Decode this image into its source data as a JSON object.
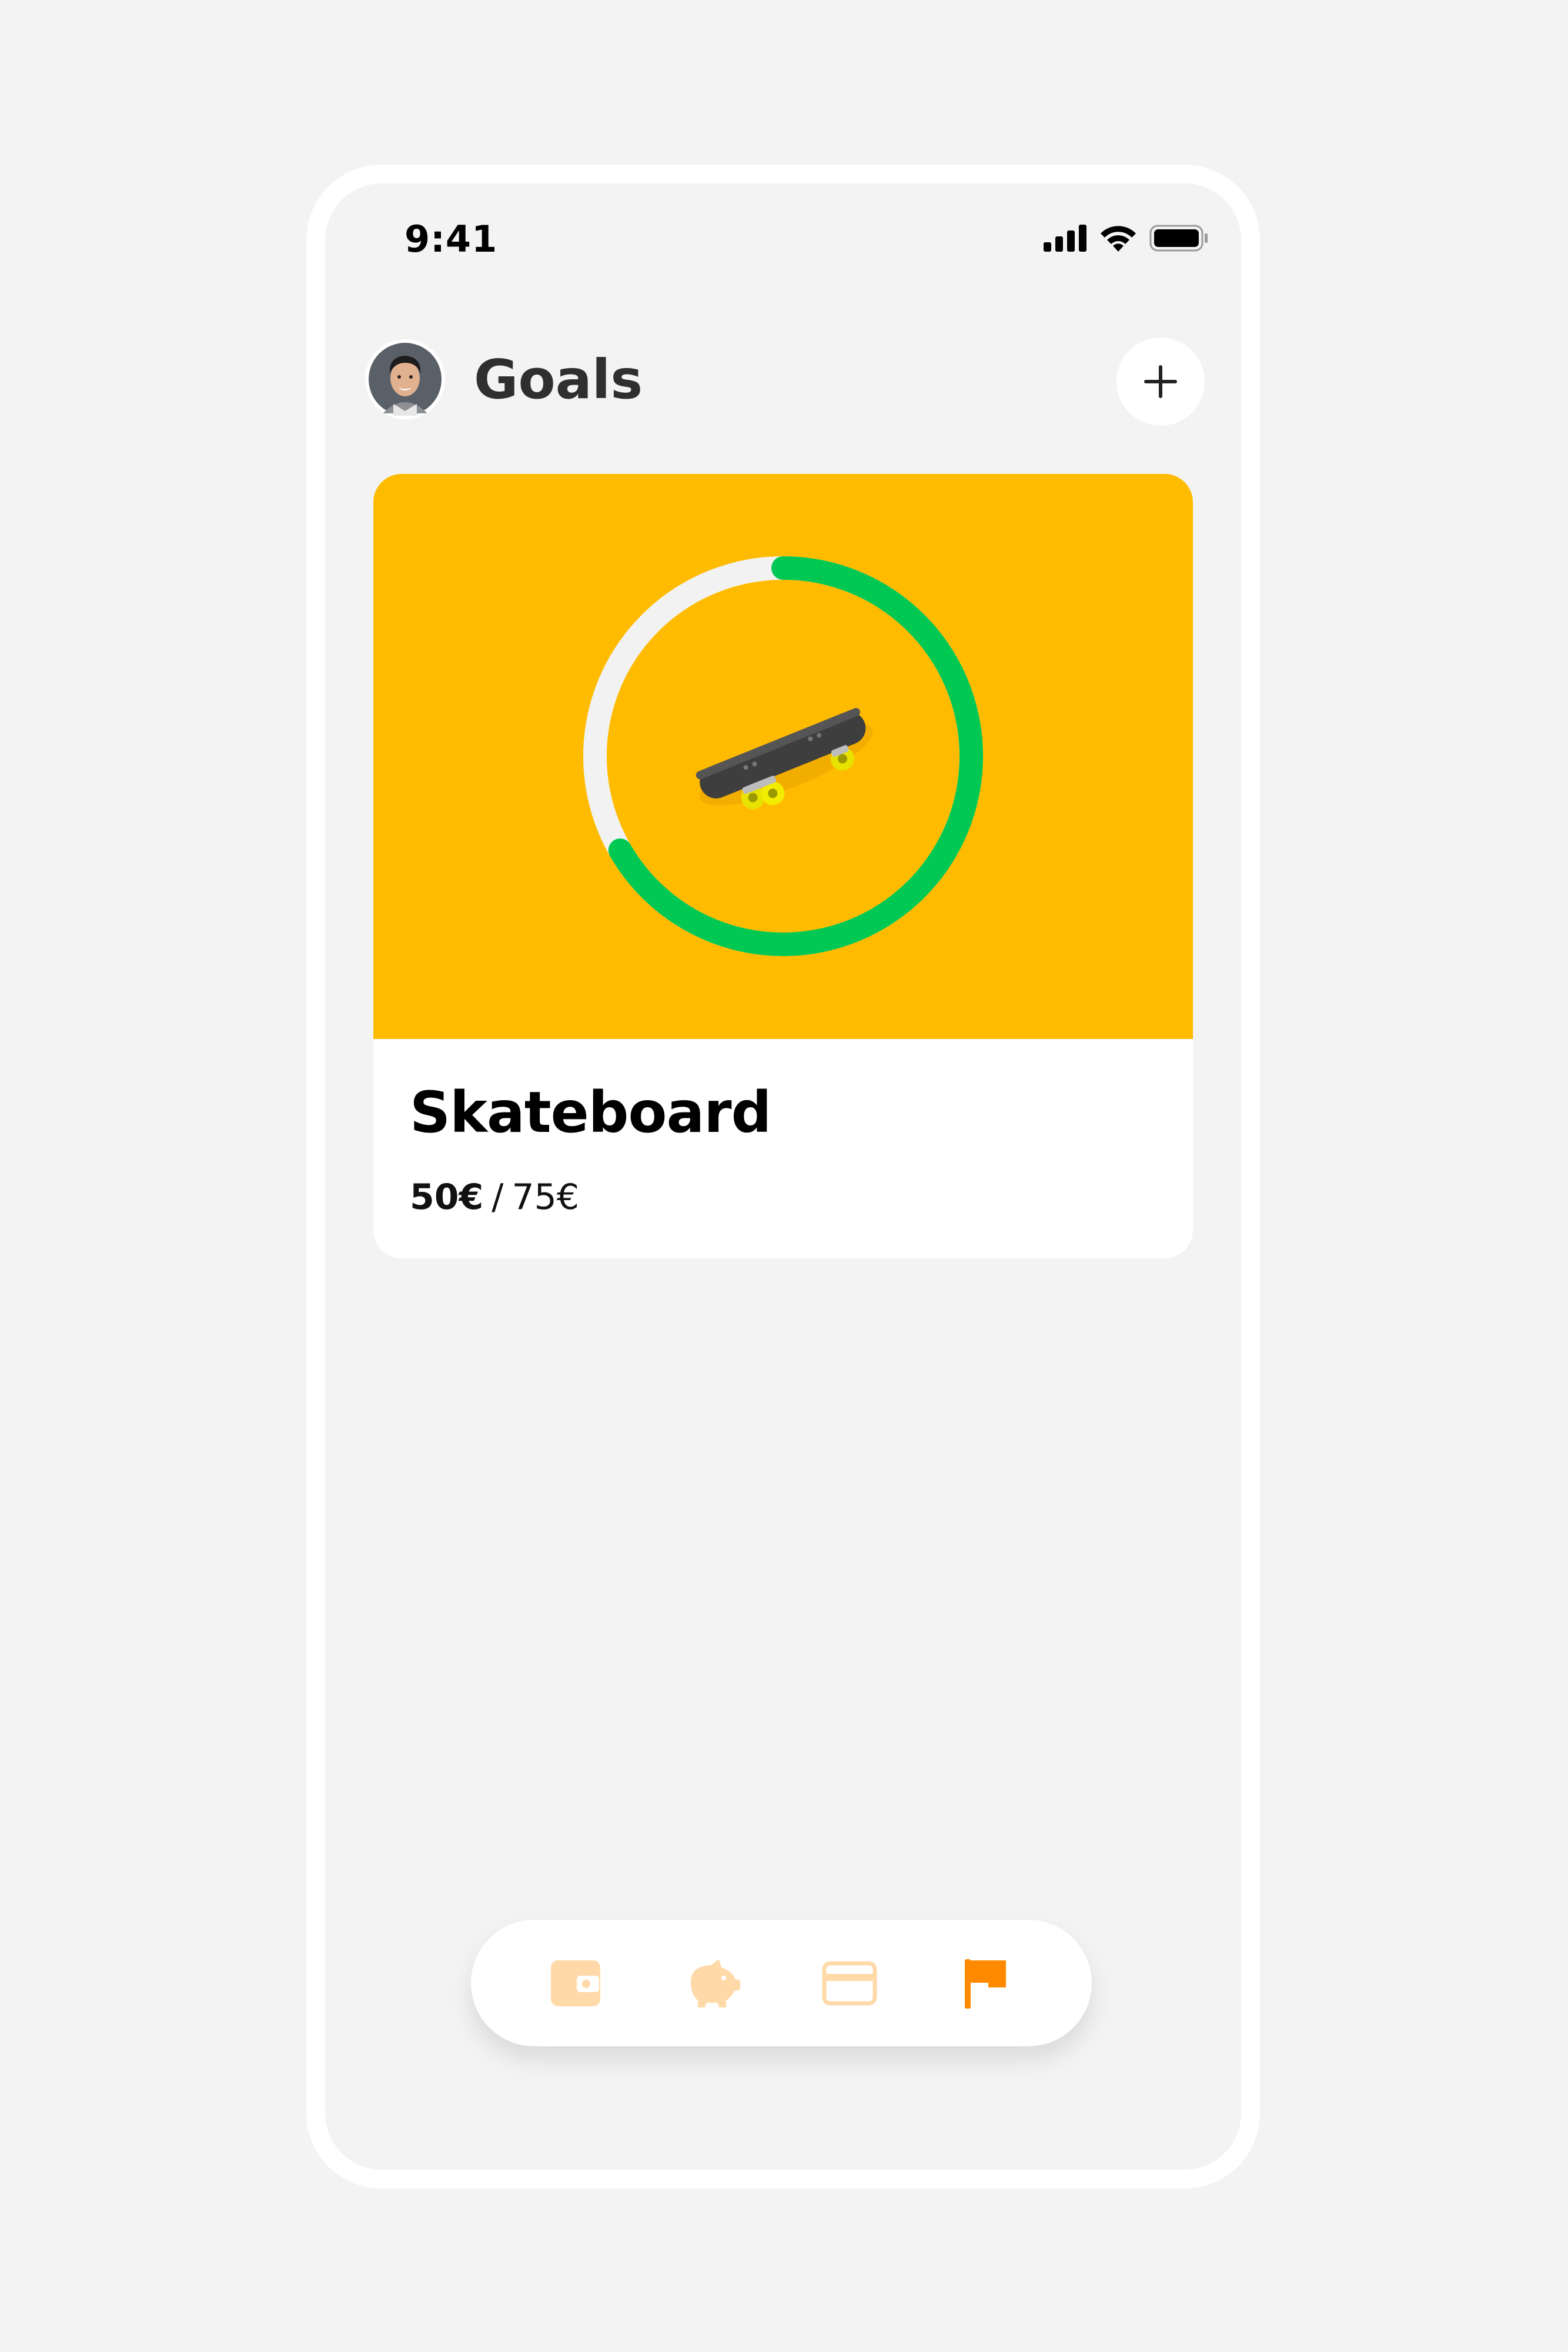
{
  "status_bar": {
    "time": "9:41",
    "icons": [
      "signal-icon",
      "wifi-icon",
      "battery-icon"
    ]
  },
  "header": {
    "title": "Goals",
    "avatar": "avatar",
    "add_icon": "plus-icon"
  },
  "goal": {
    "name": "Skateboard",
    "saved": "50€",
    "separator": "/",
    "target": "75€",
    "progress_fraction": 0.6667,
    "image": "skateboard-image",
    "hero_color": "#ffbb00",
    "progress_color": "#00c853",
    "track_color": "#f2f2f2"
  },
  "bottom_nav": {
    "items": [
      {
        "icon": "wallet-icon",
        "active": false
      },
      {
        "icon": "piggy-bank-icon",
        "active": false
      },
      {
        "icon": "card-icon",
        "active": false
      },
      {
        "icon": "flag-icon",
        "active": true
      }
    ],
    "active_color": "#ff8a00",
    "inactive_color": "#ffd9a8"
  }
}
